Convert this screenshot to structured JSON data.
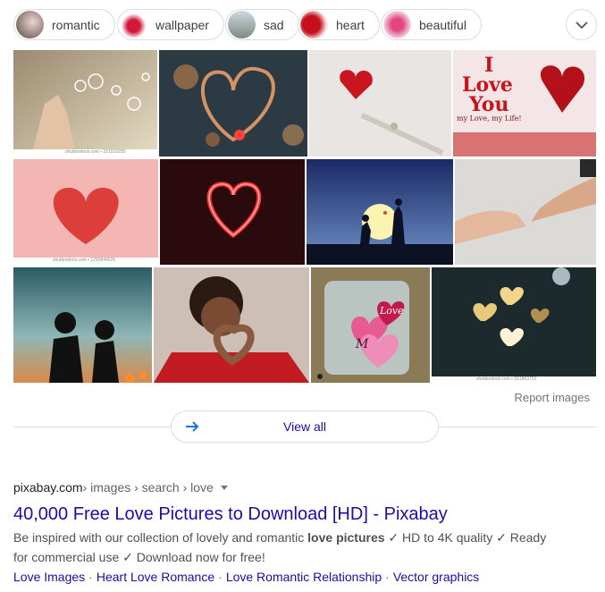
{
  "chips": [
    {
      "label": "romantic"
    },
    {
      "label": "wallpaper"
    },
    {
      "label": "sad"
    },
    {
      "label": "heart"
    },
    {
      "label": "beautiful"
    }
  ],
  "images": {
    "watermarks": [
      "shutterstock.com • 221010295",
      "shutterstock.com • 1250849526",
      "shutterstock.com • 551863753"
    ],
    "love_card_text": [
      "I",
      "Love",
      "You",
      "my Love, my Life!"
    ],
    "mug_text": [
      "Love",
      "M"
    ]
  },
  "report_label": "Report images",
  "view_all_label": "View all",
  "result": {
    "domain": "pixabay.com",
    "path": " › images › search › love",
    "title": "40,000 Free Love Pictures to Download [HD] - Pixabay",
    "snippet_pre": "Be inspired with our collection of lovely and romantic ",
    "snippet_bold": "love pictures",
    "snippet_post": " ✓ HD to 4K quality ✓ Ready for commercial use ✓ Download now for free!",
    "sitelinks": [
      "Love Images",
      "Heart Love Romance",
      "Love Romantic Relationship",
      "Vector graphics"
    ]
  },
  "colors": {
    "link": "#1a0dab",
    "border": "#dadce0",
    "muted": "#70757a"
  }
}
